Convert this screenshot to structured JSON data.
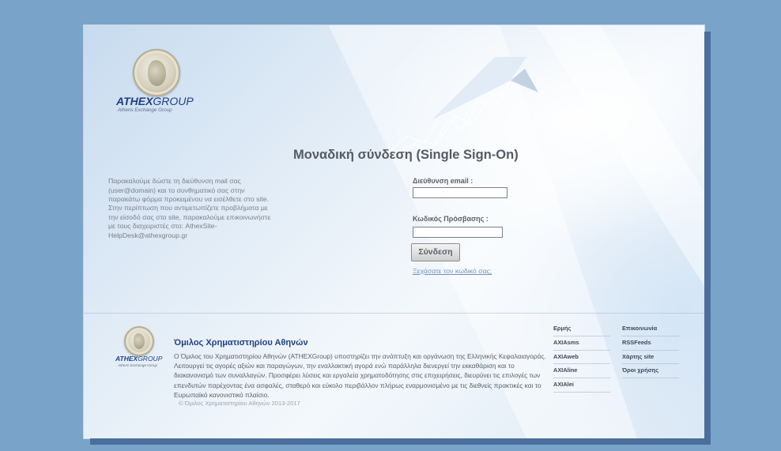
{
  "brand": {
    "name_bold": "ATHEX",
    "name_light": "GROUP",
    "subtitle": "Athens Exchange Group"
  },
  "login": {
    "title": "Μοναδική σύνδεση (Single Sign-On)",
    "info_1": "Παρακαλούμε δώστε τη διεύθυνση mail σας (user@domain) και το συνθηματικό σας στην παρακάτω φόρμα προκειμένου να εισέλθετε στο site.",
    "info_2": "Στην περίπτωση που αντιμετωπίζετε προβλήματα με την είσοδό σας στο site, παρακαλούμε επικοινωνήστε με τους διαχειριστές στο: AthexSite-HelpDesk@athexgroup.gr",
    "email_label": "Διεύθυνση email :",
    "email_value": "",
    "password_label": "Κωδικός Πρόσβασης :",
    "password_value": "",
    "submit_label": "Σύνδεση",
    "forgot_label": "Ξεχάσατε τον κωδικό σας;"
  },
  "footer": {
    "title": "Όμιλος Χρηματιστηρίου Αθηνών",
    "text": "Ο Όμιλος του Χρηματιστηρίου Αθηνών (ATHEXGroup) υποστηρίζει την ανάπτυξη και οργάνωση της Ελληνικής Κεφαλαιαγοράς. Λειτουργεί τις αγορές αξιών και παραγώγων, την εναλλακτική αγορά ενώ παράλληλα διενεργεί την εκκαθάριση και το διακανονισμό των συναλλαγών. Προσφέρει λύσεις και εργαλεία χρηματοδότησης στις επιχειρήσεις, διευρύνει τις επιλογές των επενδυτών παρέχοντας ένα ασφαλές, σταθερό και εύκολο περιβάλλον πλήρως εναρμονισμένο με τις διεθνείς πρακτικές και το Ευρωπαϊκό κανονιστικό πλαίσιο.",
    "copyright": "© Όμιλος Χρηματιστηρίου Αθηνών 2013-2017",
    "links_col1": [
      "Ερμής",
      "AXIAsms",
      "AXIAweb",
      "AXIAline",
      "AXIAlei"
    ],
    "links_col2": [
      "Επικοινωνία",
      "RSSFeeds",
      "Χάρτης site",
      "Όροι χρήσης"
    ]
  },
  "colors": {
    "page_background": "#7aa3c9",
    "brand_blue": "#1f3f86",
    "link_blue": "#6d8fbf"
  }
}
